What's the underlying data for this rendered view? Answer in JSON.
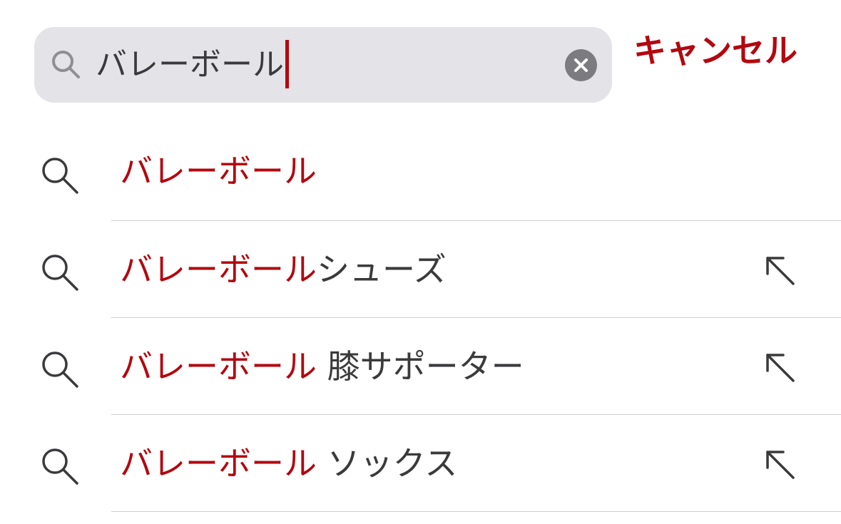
{
  "search": {
    "query": "バレーボール",
    "clear_icon": "clear-circle-icon",
    "cancel_label": "キャンセル"
  },
  "colors": {
    "accent": "#b3070f",
    "text": "#3a3a3c",
    "search_field_bg": "#e3e3e8",
    "clear_button_bg": "#7c7c80",
    "divider": "#cfcfd3"
  },
  "suggestions": [
    {
      "highlight": "バレーボール",
      "rest": "",
      "has_fill_arrow": false
    },
    {
      "highlight": "バレーボール",
      "rest": "シューズ",
      "has_fill_arrow": true
    },
    {
      "highlight": "バレーボール",
      "rest": " 膝サポーター",
      "has_fill_arrow": true
    },
    {
      "highlight": "バレーボール",
      "rest": " ソックス",
      "has_fill_arrow": true
    }
  ]
}
